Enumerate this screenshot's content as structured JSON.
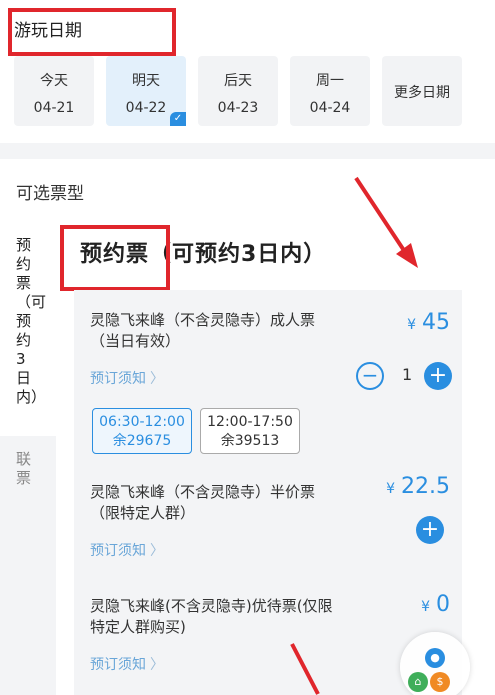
{
  "visit_date": {
    "title": "游玩日期",
    "dates": [
      {
        "weekday": "今天",
        "date": "04-21",
        "selected": false
      },
      {
        "weekday": "明天",
        "date": "04-22",
        "selected": true
      },
      {
        "weekday": "后天",
        "date": "04-23",
        "selected": false
      },
      {
        "weekday": "周一",
        "date": "04-24",
        "selected": false
      }
    ],
    "more_label": "更多日期"
  },
  "ticket_types": {
    "title": "可选票型",
    "tabs": [
      {
        "label": "预约票（可预约3日内）",
        "active": true
      },
      {
        "label": "联票",
        "active": false
      }
    ],
    "section_title": "预约票（可预约3日内）"
  },
  "tickets": [
    {
      "name": "灵隐飞来峰（不含灵隐寺）成人票（当日有效）",
      "currency": "¥",
      "price": "45",
      "quantity": "1",
      "notice": "预订须知",
      "slots": [
        {
          "time": "06:30-12:00",
          "remain": "余29675",
          "active": true
        },
        {
          "time": "12:00-17:50",
          "remain": "余39513",
          "active": false
        }
      ]
    },
    {
      "name": "灵隐飞来峰（不含灵隐寺）半价票（限特定人群）",
      "currency": "¥",
      "price": "22.5",
      "notice": "预订须知"
    },
    {
      "name": "灵隐飞来峰(不含灵隐寺)优待票(仅限特定人群购买)",
      "currency": "¥",
      "price": "0",
      "notice": "预订须知"
    }
  ],
  "colors": {
    "accent": "#2a8ee0",
    "annotation_red": "#e0262c",
    "panel_gray": "#f3f4f6"
  },
  "icons": {
    "minus": "minus-circle-icon",
    "plus": "plus-circle-icon",
    "chevron": "chevron-right-icon",
    "check": "check-icon",
    "float": "floating-menu-icon"
  }
}
